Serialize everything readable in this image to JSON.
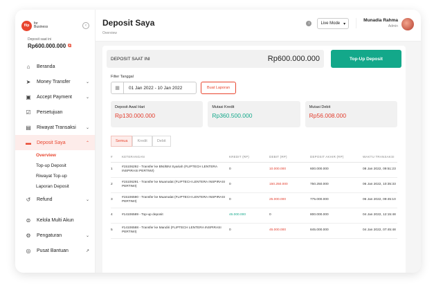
{
  "brand": {
    "logo_text": "flip",
    "for": "for",
    "business": "Business"
  },
  "sidebar": {
    "deposit_label": "Deposit saat ini",
    "deposit_value": "Rp600.000.000",
    "items": [
      {
        "label": "Beranda",
        "icon": "home-icon",
        "has_chevron": false
      },
      {
        "label": "Money Transfer",
        "icon": "send-icon",
        "has_chevron": true
      },
      {
        "label": "Accept Payment",
        "icon": "payment-icon",
        "has_chevron": true
      },
      {
        "label": "Persetujuan",
        "icon": "approval-icon",
        "has_chevron": false
      },
      {
        "label": "Riwayat Transaksi",
        "icon": "history-icon",
        "has_chevron": true
      },
      {
        "label": "Deposit Saya",
        "icon": "wallet-icon",
        "has_chevron": true
      },
      {
        "label": "Refund",
        "icon": "refund-icon",
        "has_chevron": true
      },
      {
        "label": "Kelola Multi Akun",
        "icon": "accounts-icon",
        "has_chevron": false
      },
      {
        "label": "Pengaturan",
        "icon": "gear-icon",
        "has_chevron": true
      },
      {
        "label": "Pusat Bantuan",
        "icon": "help-icon",
        "has_chevron": false
      }
    ],
    "sub_items": [
      "Overview",
      "Top-up Deposit",
      "Riwayat Top-up",
      "Laporan Deposit"
    ]
  },
  "header": {
    "title": "Deposit Saya",
    "breadcrumb": "Overview",
    "mode": "Live Mode",
    "user_name": "Munadia Rahma",
    "user_role": "Admin"
  },
  "deposit_bar": {
    "label": "DEPOSIT SAAT INI",
    "value": "Rp600.000.000",
    "topup_label": "Top-Up Deposit"
  },
  "filter": {
    "label": "Filter Tanggal",
    "date_range": "01 Jan 2022 - 10 Jan 2022",
    "report_button": "Buat Laporan"
  },
  "summary": [
    {
      "label": "Deposit Awal Hari",
      "value": "Rp130.000.000",
      "color": "#e23b2b"
    },
    {
      "label": "Mutasi Kredit",
      "value": "Rp360.500.000",
      "color": "#13a88a"
    },
    {
      "label": "Mutasi Debit",
      "value": "Rp56.008.000",
      "color": "#e23b2b"
    }
  ],
  "tabs": [
    "Semua",
    "Kredit",
    "Debit"
  ],
  "table": {
    "headers": [
      "#",
      "KETERANGAN",
      "KREDIT (RP)",
      "DEBIT (RP)",
      "DEPOSIT AKHIR (RP)",
      "WAKTU TRANSAKSI"
    ],
    "rows": [
      {
        "no": "1",
        "desc": "#15106292 - Transfer ke BNI/BNI Syariah (FLIPTECH LENTERA INSPIRASI PERTIWI)",
        "kredit": "0",
        "debit": "10.000.000",
        "akhir": "600.000.000",
        "waktu": "08 Jan 2022, 09:51:23"
      },
      {
        "no": "2",
        "desc": "#15106291 - Transfer ke Muamalat (FLIPTECH LENTERA INSPIRASI PERTIWI)",
        "kredit": "0",
        "debit": "150.250.000",
        "akhir": "750.250.000",
        "waktu": "06 Jan 2022, 10:35:33"
      },
      {
        "no": "3",
        "desc": "#15106590 - Transfer ke Muamalat (FLIPTECH LENTERA INSPIRASI PERTIWI)",
        "kredit": "0",
        "debit": "25.000.000",
        "akhir": "775.000.000",
        "waktu": "06 Jan 2022, 09:45:10"
      },
      {
        "no": "4",
        "desc": "#14106589 - Top-up deposit",
        "kredit": "45.000.000",
        "debit": "0",
        "akhir": "800.000.000",
        "waktu": "04 Jan 2022, 12:15:48"
      },
      {
        "no": "5",
        "desc": "#14106588 - Transfer ke Mandiri (FLIPTECH LENTERA INSPIRASI PERTIWI)",
        "kredit": "0",
        "debit": "45.000.000",
        "akhir": "845.000.000",
        "waktu": "04 Jan 2022, 07:45:48"
      }
    ]
  },
  "colors": {
    "accent": "#e8452e",
    "green": "#13a88a",
    "red": "#e23b2b"
  }
}
